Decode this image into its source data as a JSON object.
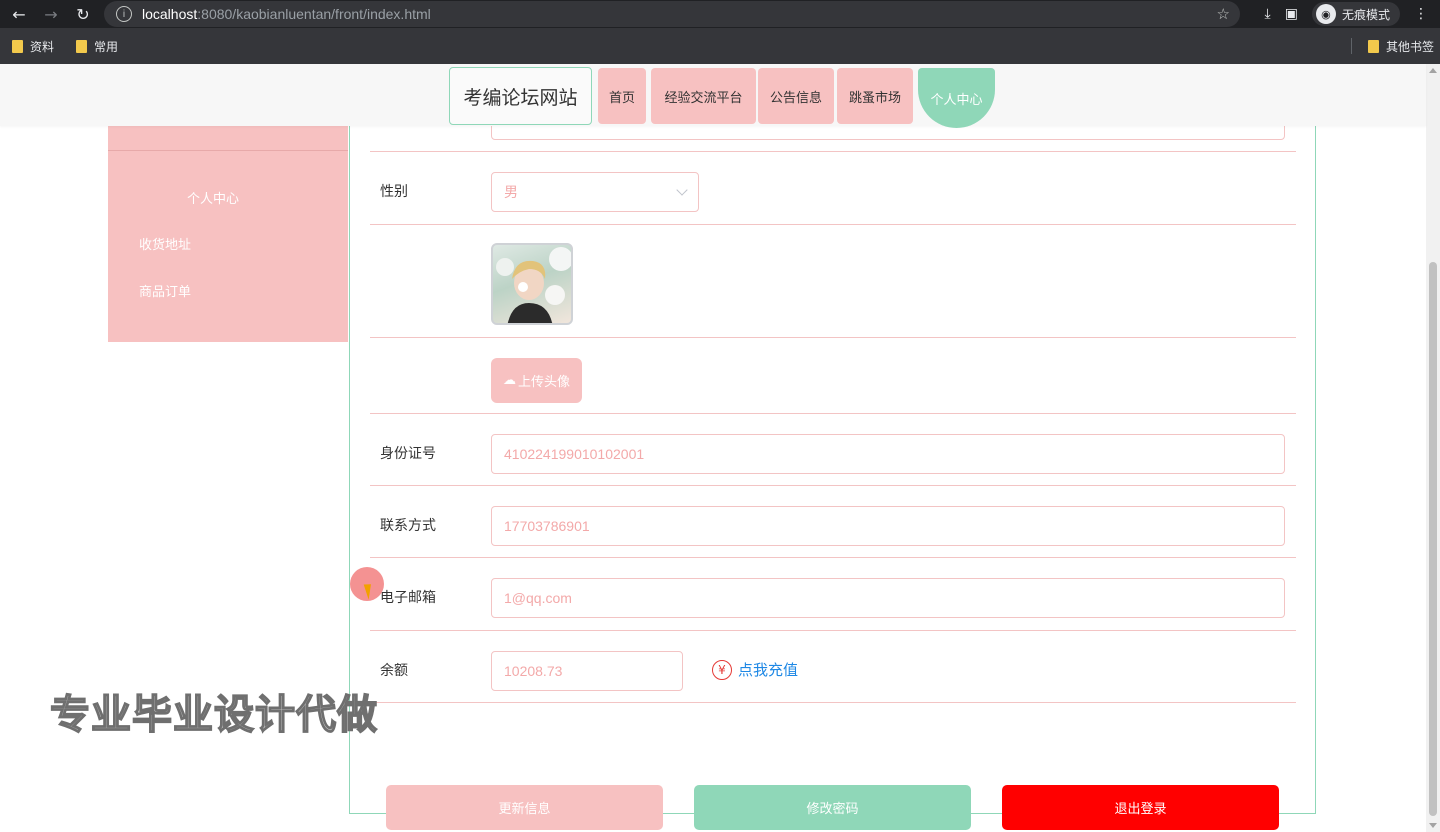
{
  "browser": {
    "url_host": "localhost",
    "url_rest": ":8080/kaobianluentan/front/index.html",
    "incognito_label": "无痕模式",
    "bookmarks": [
      "资料",
      "常用"
    ],
    "other_bookmarks": "其他书签"
  },
  "nav": {
    "logo": "考编论坛网站",
    "items": [
      "首页",
      "经验交流平台",
      "公告信息",
      "跳蚤市场",
      "个人中心"
    ],
    "active_color": "#8fd7b8",
    "item_color": "#f7c1c1"
  },
  "sidebar": {
    "title": "个人中心",
    "items": [
      "收货地址",
      "商品订单"
    ]
  },
  "form": {
    "gender_label": "性别",
    "gender_value": "男",
    "upload_label": "上传头像",
    "id_label": "身份证号",
    "id_value": "410224199010102001",
    "phone_label": "联系方式",
    "phone_value": "17703786901",
    "email_label": "电子邮箱",
    "email_value": "1@qq.com",
    "balance_label": "余额",
    "balance_value": "10208.73",
    "recharge_label": "点我充值",
    "yen_symbol": "¥"
  },
  "actions": {
    "update": "更新信息",
    "change_password": "修改密码",
    "logout": "退出登录",
    "update_color": "#f7c1c1",
    "password_color": "#8fd7b8",
    "logout_color": "#ff0000"
  },
  "watermark": "专业毕业设计代做"
}
